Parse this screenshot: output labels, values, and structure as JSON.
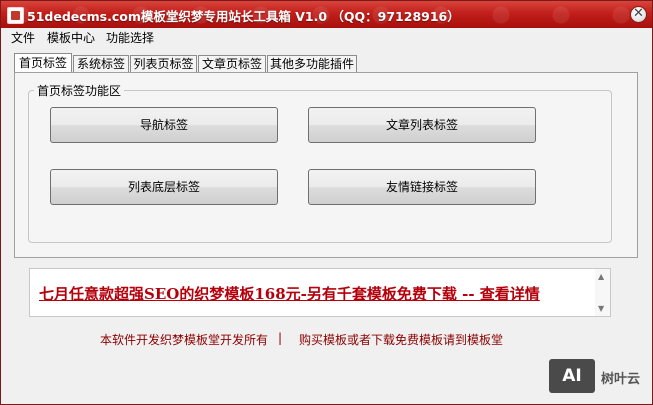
{
  "window": {
    "title": "51dedecms.com模板堂织梦专用站长工具箱 V1.0 （QQ：97128916）",
    "close_label": "✕"
  },
  "menu": [
    "文件",
    "模板中心",
    "功能选择"
  ],
  "tabs": [
    "首页标签",
    "系统标签",
    "列表页标签",
    "文章页标签",
    "其他多功能插件"
  ],
  "active_tab": 0,
  "group": {
    "title": "首页标签功能区",
    "buttons": [
      "导航标签",
      "文章列表标签",
      "列表底层标签",
      "友情链接标签"
    ]
  },
  "ad": {
    "text": "七月任意款超强SEO的织梦模板168元-另有千套模板免费下载 -- 查看详情"
  },
  "footer": {
    "left": "本软件开发织梦模板堂开发所有",
    "separator": "|",
    "right": "购买模板或者下载免费模板请到模板堂"
  },
  "watermark": {
    "logo": "AI",
    "text": "树叶云"
  },
  "colors": {
    "titlebar": "#c11f1a",
    "ad_text": "#b5000b",
    "footer_text": "#8b0000"
  },
  "icons": [
    "app-icon",
    "close-icon",
    "scroll-up-icon",
    "scroll-down-icon"
  ]
}
